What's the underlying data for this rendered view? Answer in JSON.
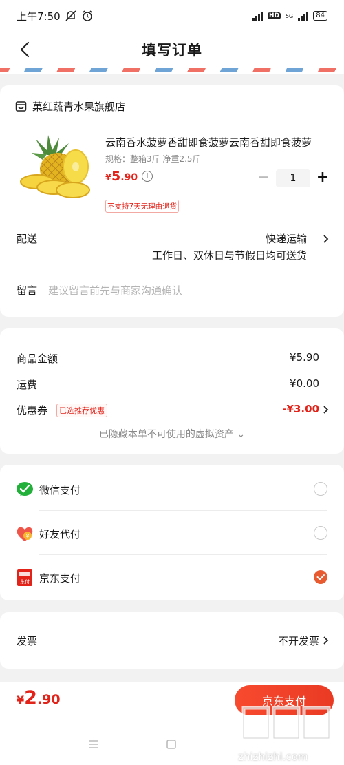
{
  "status_bar": {
    "time": "上午7:50",
    "hd_label": "HD",
    "net_label": "5G",
    "battery": "84"
  },
  "nav": {
    "title": "填写订单"
  },
  "order": {
    "store_name": "菓红蔬青水果旗舰店",
    "product": {
      "title": "云南香水菠萝香甜即食菠萝云南香甜即食菠萝",
      "spec": "规格：整箱3斤  净重2.5斤",
      "price_symbol": "¥",
      "price_int": "5",
      "price_dec": ".90",
      "quantity": "1",
      "return_notice": "不支持7天无理由退货"
    },
    "delivery": {
      "label": "配送",
      "method": "快递运输",
      "schedule": "工作日、双休日与节假日均可送货"
    },
    "remark": {
      "label": "留言",
      "placeholder": "建议留言前先与商家沟通确认"
    }
  },
  "amounts": {
    "goods_label": "商品金额",
    "goods_value": "¥5.90",
    "shipping_label": "运费",
    "shipping_value": "¥0.00",
    "coupon_label": "优惠券",
    "coupon_badge": "已选推荐优惠",
    "coupon_value": "-¥3.00",
    "hidden_assets": "已隐藏本单不可使用的虚拟资产 ⌄"
  },
  "payment": {
    "methods": [
      {
        "label": "微信支付",
        "icon": "wechat-pay-icon",
        "selected": false
      },
      {
        "label": "好友代付",
        "icon": "friend-pay-icon",
        "selected": false
      },
      {
        "label": "京东支付",
        "icon": "jd-pay-icon",
        "selected": true
      }
    ],
    "selected_color": "#e85a30"
  },
  "invoice": {
    "label": "发票",
    "value": "不开发票"
  },
  "footer": {
    "total_symbol": "¥",
    "total_int": "2",
    "total_dec": ".90",
    "pay_button": "京东支付",
    "watermark_text": "zhizhizhi.com"
  },
  "colors": {
    "accent_red": "#e2231a",
    "button_orange": "#f74a2e"
  }
}
